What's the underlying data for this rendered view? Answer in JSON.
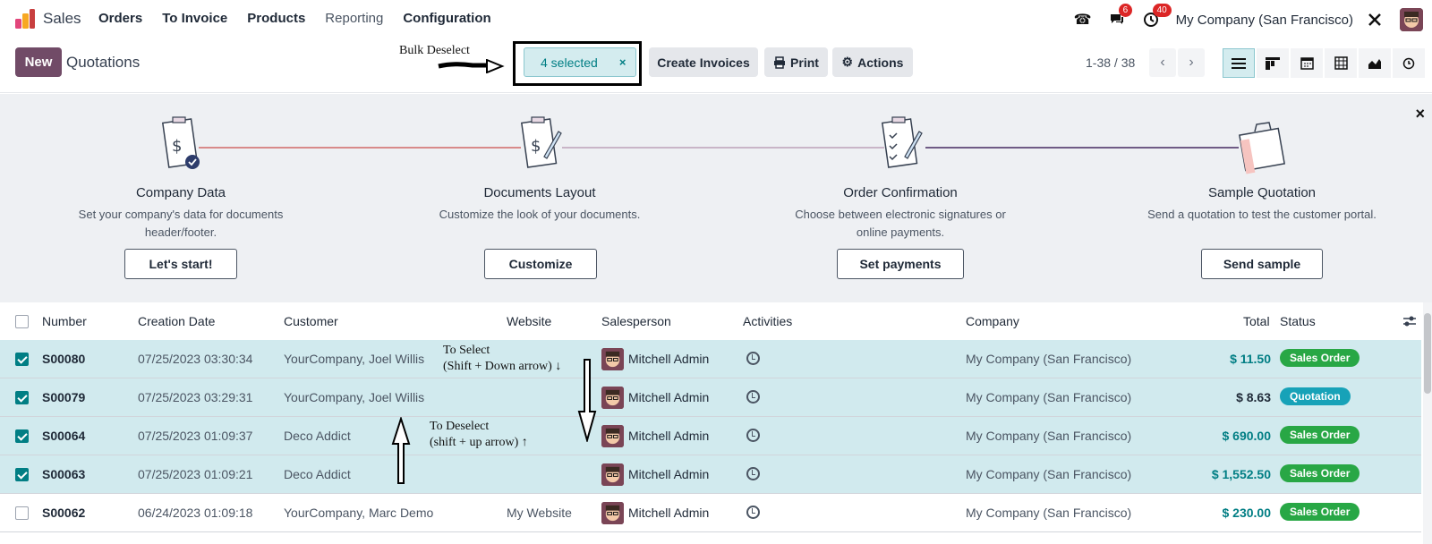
{
  "nav": {
    "app_name": "Sales",
    "menu": [
      "Orders",
      "To Invoice",
      "Products",
      "Reporting",
      "Configuration"
    ],
    "badges": {
      "messages": "6",
      "activities": "40"
    },
    "company": "My Company (San Francisco)"
  },
  "control": {
    "new_label": "New",
    "breadcrumb": "Quotations",
    "selected_label": "4 selected",
    "selected_clear": "×",
    "create_invoices": "Create Invoices",
    "print": "Print",
    "actions": "Actions",
    "pager": "1-38 / 38"
  },
  "annotations": {
    "bulk_deselect": "Bulk Deselect",
    "to_select_1": "To Select",
    "to_select_2": "(Shift + Down arrow) ↓",
    "to_deselect_1": "To Deselect",
    "to_deselect_2": "(shift + up arrow) ↑"
  },
  "onboarding": {
    "steps": [
      {
        "title": "Company Data",
        "desc": "Set your company's data for documents header/footer.",
        "button": "Let's start!"
      },
      {
        "title": "Documents Layout",
        "desc": "Customize the look of your documents.",
        "button": "Customize"
      },
      {
        "title": "Order Confirmation",
        "desc": "Choose between electronic signatures or online payments.",
        "button": "Set payments"
      },
      {
        "title": "Sample Quotation",
        "desc": "Send a quotation to test the customer portal.",
        "button": "Send sample"
      }
    ],
    "close": "×"
  },
  "table": {
    "headers": {
      "number": "Number",
      "creation_date": "Creation Date",
      "customer": "Customer",
      "website": "Website",
      "salesperson": "Salesperson",
      "activities": "Activities",
      "company": "Company",
      "total": "Total",
      "status": "Status"
    },
    "rows": [
      {
        "selected": true,
        "number": "S00080",
        "date": "07/25/2023 03:30:34",
        "customer": "YourCompany, Joel Willis",
        "website": "",
        "salesperson": "Mitchell Admin",
        "company": "My Company (San Francisco)",
        "total": "$ 11.50",
        "status": "Sales Order"
      },
      {
        "selected": true,
        "number": "S00079",
        "date": "07/25/2023 03:29:31",
        "customer": "YourCompany, Joel Willis",
        "website": "",
        "salesperson": "Mitchell Admin",
        "company": "My Company (San Francisco)",
        "total": "$ 8.63",
        "status": "Quotation"
      },
      {
        "selected": true,
        "number": "S00064",
        "date": "07/25/2023 01:09:37",
        "customer": "Deco Addict",
        "website": "",
        "salesperson": "Mitchell Admin",
        "company": "My Company (San Francisco)",
        "total": "$ 690.00",
        "status": "Sales Order"
      },
      {
        "selected": true,
        "number": "S00063",
        "date": "07/25/2023 01:09:21",
        "customer": "Deco Addict",
        "website": "",
        "salesperson": "Mitchell Admin",
        "company": "My Company (San Francisco)",
        "total": "$ 1,552.50",
        "status": "Sales Order"
      },
      {
        "selected": false,
        "number": "S00062",
        "date": "06/24/2023 01:09:18",
        "customer": "YourCompany, Marc Demo",
        "website": "My Website",
        "salesperson": "Mitchell Admin",
        "company": "My Company (San Francisco)",
        "total": "$ 230.00",
        "status": "Sales Order"
      }
    ]
  },
  "colors": {
    "brand": "#714b67",
    "accent": "#017e84",
    "selected_row": "#d1eaee",
    "sales_order": "#28a745",
    "quotation": "#17a2b8"
  }
}
